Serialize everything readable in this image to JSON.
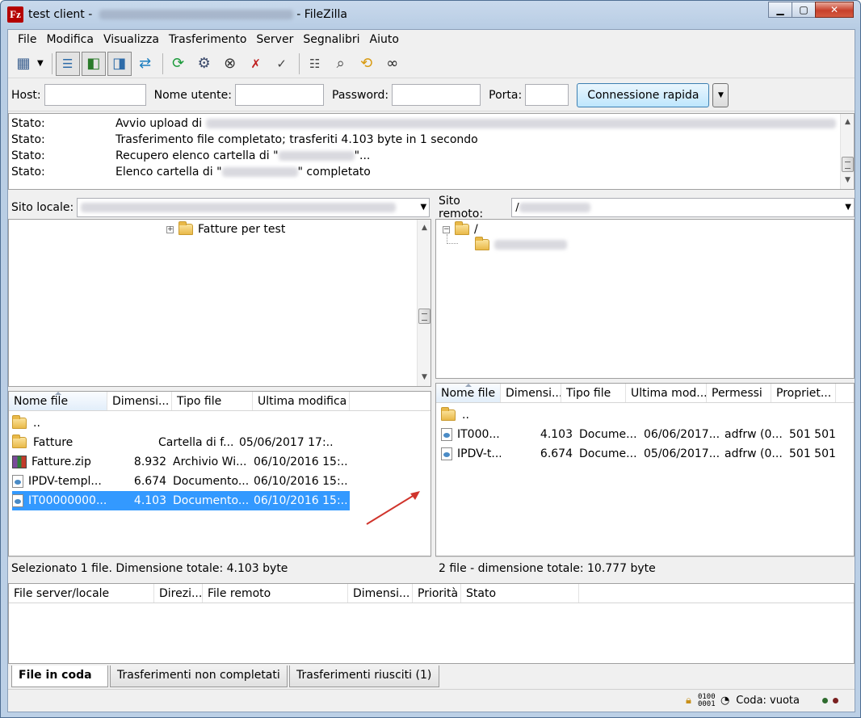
{
  "window": {
    "title": "test client - ",
    "title_suffix": "FileZilla"
  },
  "menu": [
    "File",
    "Modifica",
    "Visualizza",
    "Trasferimento",
    "Server",
    "Segnalibri",
    "Aiuto"
  ],
  "toolbar": {
    "icons": [
      "site-manager-icon",
      "toggle-log-icon",
      "toggle-local-tree-icon",
      "toggle-remote-tree-icon",
      "toggle-queue-icon",
      "refresh-icon",
      "process-queue-icon",
      "cancel-icon",
      "disconnect-icon",
      "reconnect-icon",
      "filter-icon",
      "compare-icon",
      "sync-browse-icon",
      "search-icon"
    ]
  },
  "quickconnect": {
    "host_label": "Host:",
    "user_label": "Nome utente:",
    "pass_label": "Password:",
    "port_label": "Porta:",
    "connect_label": "Connessione rapida"
  },
  "log": [
    {
      "label": "Stato:",
      "text": "Avvio upload di "
    },
    {
      "label": "Stato:",
      "text": "Trasferimento file completato; trasferiti 4.103 byte in 1 secondo"
    },
    {
      "label": "Stato:",
      "text": "Recupero elenco cartella di \"",
      "text_end": "\"..."
    },
    {
      "label": "Stato:",
      "text": "Elenco cartella di \"",
      "text_end": "\" completato"
    }
  ],
  "local": {
    "site_label": "Sito locale:",
    "tree_node": "Fatture per test",
    "headers": [
      "Nome file",
      "Dimensi...",
      "Tipo file",
      "Ultima modifica"
    ],
    "rows": [
      {
        "name": "..",
        "size": "",
        "type": "",
        "modified": "",
        "icon": "folder"
      },
      {
        "name": "Fatture",
        "size": "",
        "type": "Cartella di f...",
        "modified": "05/06/2017 17:...",
        "icon": "folder"
      },
      {
        "name": "Fatture.zip",
        "size": "8.932",
        "type": "Archivio Wi...",
        "modified": "06/10/2016 15:...",
        "icon": "zip"
      },
      {
        "name": "IPDV-templ...",
        "size": "6.674",
        "type": "Documento...",
        "modified": "06/10/2016 15:...",
        "icon": "file"
      },
      {
        "name": "IT00000000...",
        "size": "4.103",
        "type": "Documento...",
        "modified": "06/10/2016 15:...",
        "icon": "file",
        "selected": true
      }
    ],
    "status": "Selezionato 1 file. Dimensione totale: 4.103 byte"
  },
  "remote": {
    "site_label": "Sito remoto:",
    "path_prefix": "/",
    "tree_root": "/",
    "headers": [
      "Nome file",
      "Dimensi...",
      "Tipo file",
      "Ultima mod...",
      "Permessi",
      "Propriet..."
    ],
    "rows": [
      {
        "name": "..",
        "size": "",
        "type": "",
        "modified": "",
        "perms": "",
        "owner": "",
        "icon": "folder"
      },
      {
        "name": "IT000...",
        "size": "4.103",
        "type": "Docume...",
        "modified": "06/06/2017...",
        "perms": "adfrw (0...",
        "owner": "501 501",
        "icon": "file"
      },
      {
        "name": "IPDV-t...",
        "size": "6.674",
        "type": "Docume...",
        "modified": "05/06/2017...",
        "perms": "adfrw (0...",
        "owner": "501 501",
        "icon": "file"
      }
    ],
    "status": "2 file - dimensione totale: 10.777 byte"
  },
  "queue": {
    "headers": [
      "File server/locale",
      "Direzi...",
      "File remoto",
      "Dimensi...",
      "Priorità",
      "Stato"
    ]
  },
  "tabs": [
    "File in coda",
    "Trasferimenti non completati",
    "Trasferimenti riusciti (1)"
  ],
  "statusbar": {
    "queue": "Coda: vuota",
    "binary": "0100 0001"
  },
  "colors": {
    "selection": "#3399ff",
    "annotation_arrow": "#d0342c"
  }
}
